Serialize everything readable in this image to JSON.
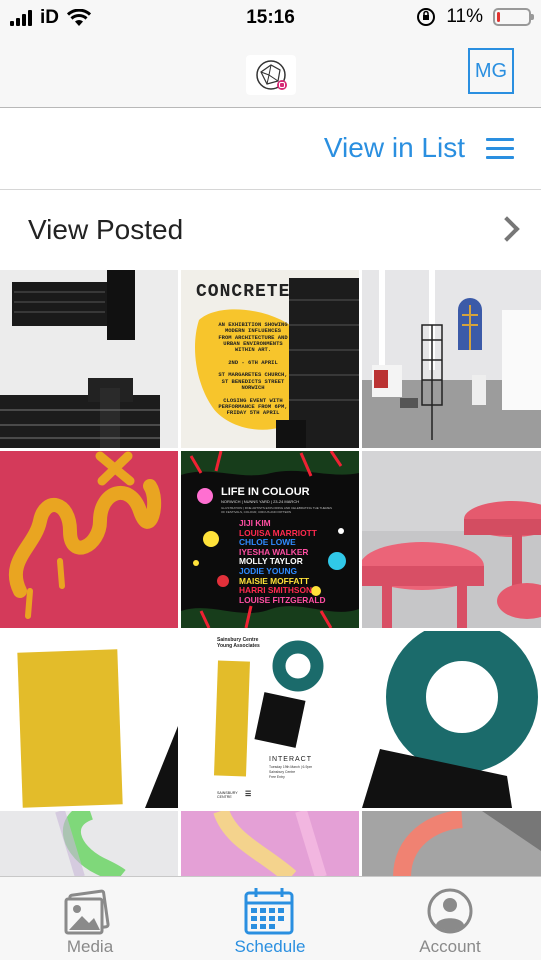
{
  "status_bar": {
    "carrier": "iD",
    "time": "15:16",
    "battery": "11%",
    "battery_level": 0.11
  },
  "header": {
    "avatar_initials": "MG"
  },
  "view_toggle": {
    "label": "View in List",
    "icon": "hamburger-menu-icon"
  },
  "posted_row": {
    "label": "View Posted",
    "icon": "chevron-right-icon"
  },
  "grid": {
    "concrete": {
      "title": "CONCRETE",
      "lines": [
        "AN EXHIBITION SHOWING",
        "MODERN INFLUENCES",
        "FROM ARCHITECTURE AND",
        "URBAN ENVIRONMENTS",
        "WITHIN ART.",
        "",
        "2ND - 6TH APRIL",
        "",
        "ST MARGARETES CHURCH,",
        "ST BENEDICTS STREET",
        "NORWICH",
        "",
        "CLOSING EVENT WITH",
        "PERFORMANCE FROM 6PM,",
        "FRIDAY 5TH APRIL"
      ]
    },
    "life_in_colour": {
      "title": "LIFE IN COLOUR",
      "subtitle": "NORWICH | NUNNS YARD | 23-24 MARCH",
      "desc1": "ILLUSTRATION | FINE ARTISTS EXPLORING AND CELEBRATING THE THEMES",
      "desc2": "OF FESTIVALS, COLOUR, CIRCUS AND PATTERN",
      "artists": [
        {
          "name": "JIJI KIM",
          "color": "#ff4fa3"
        },
        {
          "name": "LOUISA MARRIOTT",
          "color": "#ff2a4f"
        },
        {
          "name": "CHLOE LOWE",
          "color": "#2f8bff"
        },
        {
          "name": "IYESHA WALKER",
          "color": "#ff4fa3"
        },
        {
          "name": "MOLLY TAYLOR",
          "color": "#ffffff"
        },
        {
          "name": "JODIE YOUNG",
          "color": "#2f8bff"
        },
        {
          "name": "MAISIE MOFFATT",
          "color": "#ffe23a"
        },
        {
          "name": "HARRI SMITHSON",
          "color": "#ff2a4f"
        },
        {
          "name": "LOUISE FITZGERALD",
          "color": "#ff4fa3"
        }
      ]
    },
    "interact": {
      "org": "Sainsbury Centre",
      "org2": "Young Associates",
      "title": "INTERACT",
      "detail1": "Tuesday 19th March | 6-9pm",
      "detail2": "Sainsbury Centre",
      "detail3": "Free Entry",
      "footer": "SAINSBURY CENTRE"
    }
  },
  "tab_bar": {
    "items": [
      {
        "label": "Media",
        "icon": "media-image-icon",
        "active": false
      },
      {
        "label": "Schedule",
        "icon": "calendar-icon",
        "active": true
      },
      {
        "label": "Account",
        "icon": "account-person-icon",
        "active": false
      }
    ]
  },
  "colors": {
    "accent": "#2a8fe0",
    "concrete_yellow": "#f7c52c",
    "teal": "#1b6b6b",
    "mustard": "#e3bc2a"
  }
}
